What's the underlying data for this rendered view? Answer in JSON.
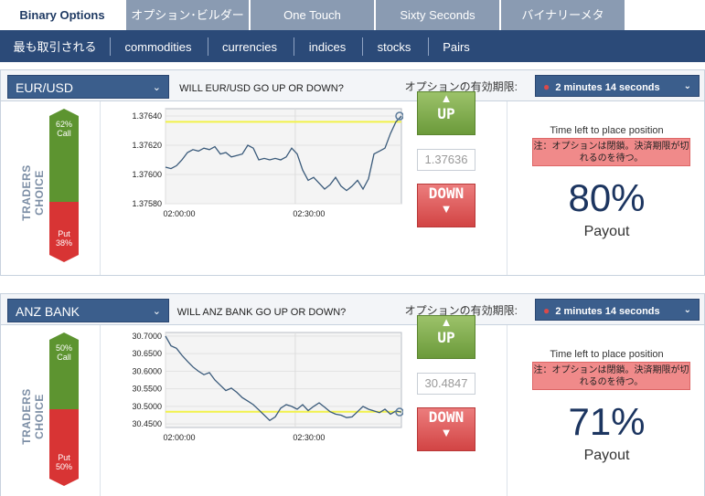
{
  "tabs": [
    {
      "label": "Binary Options",
      "active": true
    },
    {
      "label": "オプション･ビルダー",
      "active": false
    },
    {
      "label": "One Touch",
      "active": false
    },
    {
      "label": "Sixty Seconds",
      "active": false
    },
    {
      "label": "バイナリーメタ",
      "active": false
    }
  ],
  "subnav": [
    "最も取引される",
    "commodities",
    "currencies",
    "indices",
    "stocks",
    "Pairs"
  ],
  "colors": {
    "accent": "#2b4a78",
    "call": "#5d9430",
    "put": "#d83434",
    "threshold": "#f2f24a",
    "line": "#3a5a7a"
  },
  "panels": [
    {
      "asset": "EUR/USD",
      "expiry_label": "オプションの有効期限:",
      "timer": "2 minutes 14 seconds",
      "traders_choice": "TRADERS CHOICE",
      "call_pct": 62,
      "call_label": "62%",
      "call_text": "Call",
      "put_label": "38%",
      "put_text": "Put",
      "chart_title": "WILL EUR/USD GO UP OR DOWN?",
      "up_label": "UP",
      "down_label": "DOWN",
      "price": "1.37636",
      "time_left_label": "Time left to place position",
      "closed_msg": "注：オプションは閉鎖。決済期限が切れるのを待つ。",
      "payout_pct": "80%",
      "payout_label": "Payout"
    },
    {
      "asset": "ANZ BANK",
      "expiry_label": "オプションの有効期限:",
      "timer": "2 minutes 14 seconds",
      "traders_choice": "TRADERS CHOICE",
      "call_pct": 50,
      "call_label": "50%",
      "call_text": "Call",
      "put_label": "50%",
      "put_text": "Put",
      "chart_title": "WILL ANZ BANK GO UP OR DOWN?",
      "up_label": "UP",
      "down_label": "DOWN",
      "price": "30.4847",
      "time_left_label": "Time left to place position",
      "closed_msg": "注：オプションは閉鎖。決済期限が切れるのを待つ。",
      "payout_pct": "71%",
      "payout_label": "Payout"
    }
  ],
  "chart_data": [
    {
      "type": "line",
      "title": "WILL EUR/USD GO UP OR DOWN?",
      "x_ticks": [
        "02:00:00",
        "02:30:00"
      ],
      "x_tick_pos": [
        0.0,
        0.55
      ],
      "y_ticks": [
        "1.37640",
        "1.37620",
        "1.37600",
        "1.37580"
      ],
      "ylim": [
        1.3758,
        1.37645
      ],
      "threshold": 1.37636,
      "grid": true,
      "values": [
        1.37605,
        1.37604,
        1.37606,
        1.3761,
        1.37615,
        1.37617,
        1.37616,
        1.37618,
        1.37617,
        1.37619,
        1.37614,
        1.37615,
        1.37612,
        1.37613,
        1.37614,
        1.3762,
        1.37618,
        1.3761,
        1.37611,
        1.3761,
        1.37611,
        1.3761,
        1.37612,
        1.37618,
        1.37614,
        1.37603,
        1.37596,
        1.37598,
        1.37594,
        1.3759,
        1.37593,
        1.37598,
        1.37592,
        1.37589,
        1.37592,
        1.37596,
        1.3759,
        1.37597,
        1.37614,
        1.37616,
        1.37618,
        1.37628,
        1.37636,
        1.3764
      ]
    },
    {
      "type": "line",
      "title": "WILL ANZ BANK GO UP OR DOWN?",
      "x_ticks": [
        "02:00:00",
        "02:30:00"
      ],
      "x_tick_pos": [
        0.0,
        0.55
      ],
      "y_ticks": [
        "30.7000",
        "30.6500",
        "30.6000",
        "30.5500",
        "30.5000",
        "30.4500"
      ],
      "ylim": [
        30.44,
        30.71
      ],
      "threshold": 30.4847,
      "grid": true,
      "values": [
        30.7,
        30.672,
        30.665,
        30.645,
        30.628,
        30.612,
        30.6,
        30.59,
        30.596,
        30.575,
        30.56,
        30.545,
        30.552,
        30.54,
        30.525,
        30.515,
        30.505,
        30.49,
        30.475,
        30.46,
        30.47,
        30.495,
        30.505,
        30.5,
        30.492,
        30.505,
        30.488,
        30.5,
        30.51,
        30.498,
        30.485,
        30.478,
        30.475,
        30.468,
        30.47,
        30.485,
        30.5,
        30.492,
        30.487,
        30.482,
        30.492,
        30.478,
        30.487,
        30.484
      ]
    }
  ]
}
